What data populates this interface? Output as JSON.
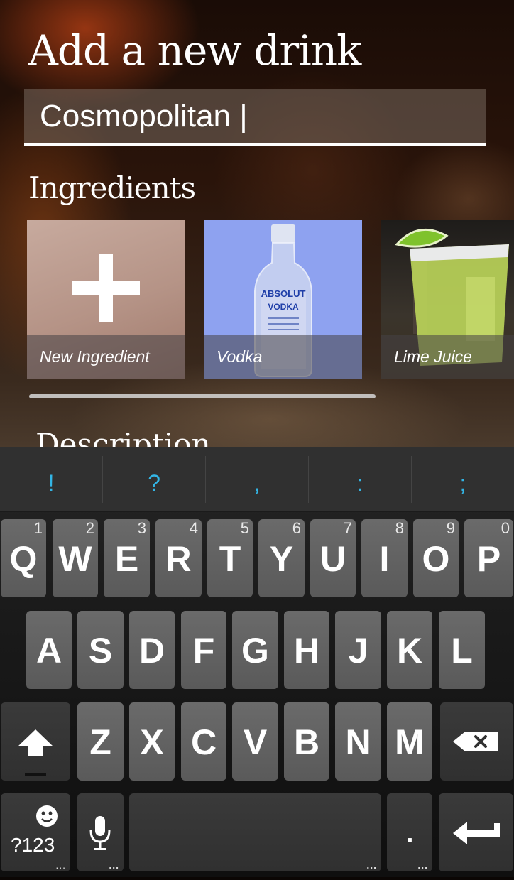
{
  "header": {
    "title": "Add a new drink"
  },
  "drink_name": {
    "value": "Cosmopolitan |"
  },
  "ingredients": {
    "section_title": "Ingredients",
    "items": [
      {
        "label": "New Ingredient"
      },
      {
        "label": "Vodka"
      },
      {
        "label": "Lime Juice"
      }
    ]
  },
  "description": {
    "section_title": "Description"
  },
  "vodka_bottle": {
    "brand": "ABSOLUT",
    "product": "VODKA"
  },
  "keyboard": {
    "suggestions": [
      "!",
      "?",
      ",",
      ":",
      ";"
    ],
    "row1": [
      {
        "key": "Q",
        "num": "1"
      },
      {
        "key": "W",
        "num": "2"
      },
      {
        "key": "E",
        "num": "3"
      },
      {
        "key": "R",
        "num": "4"
      },
      {
        "key": "T",
        "num": "5"
      },
      {
        "key": "Y",
        "num": "6"
      },
      {
        "key": "U",
        "num": "7"
      },
      {
        "key": "I",
        "num": "8"
      },
      {
        "key": "O",
        "num": "9"
      },
      {
        "key": "P",
        "num": "0"
      }
    ],
    "row2": [
      "A",
      "S",
      "D",
      "F",
      "G",
      "H",
      "J",
      "K",
      "L"
    ],
    "row3": [
      "Z",
      "X",
      "C",
      "V",
      "B",
      "N",
      "M"
    ],
    "symbols_label": "?123",
    "period_label": ".",
    "accent_color": "#33b5e5"
  }
}
